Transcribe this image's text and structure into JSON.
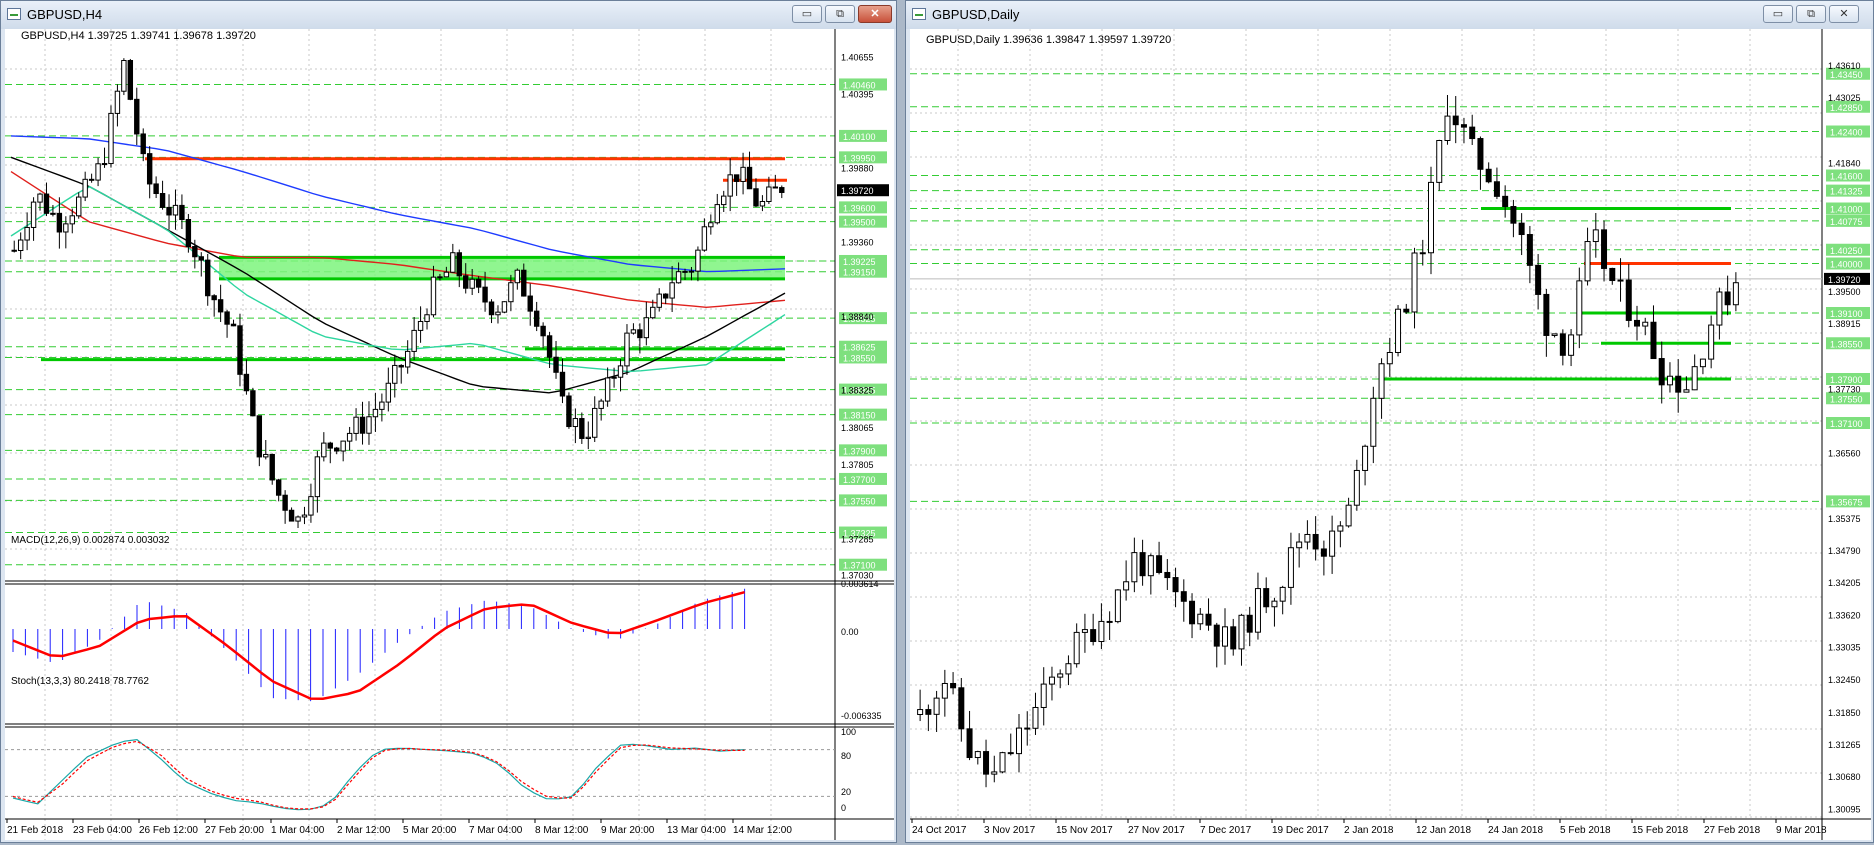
{
  "windows": {
    "h4": {
      "title": "GBPUSD,H4",
      "header": "GBPUSD,H4  1.39725 1.39741 1.39678 1.39720",
      "current_price": "1.39720",
      "price_labels": [
        "1.40655",
        "1.40395",
        "1.39880",
        "1.39360",
        "1.38840",
        "1.38325",
        "1.38065",
        "1.37805",
        "1.37285",
        "1.37030"
      ],
      "green_labels": [
        "1.40460",
        "1.40100",
        "1.39950",
        "1.39600",
        "1.39500",
        "1.39225",
        "1.39150",
        "1.38825",
        "1.38625",
        "1.38550",
        "1.38325",
        "1.38150",
        "1.37900",
        "1.37700",
        "1.37550",
        "1.37325",
        "1.37100"
      ],
      "macd": {
        "header": "MACD(12,26,9) 0.002874 0.003032",
        "labels": [
          "0.003614",
          "0.00",
          "-0.006335"
        ]
      },
      "stoch": {
        "header": "Stoch(13,3,3) 80.2418 78.7762",
        "labels": [
          "100",
          "80",
          "20",
          "0"
        ]
      },
      "time_labels": [
        "21 Feb 2018",
        "23 Feb 04:00",
        "26 Feb 12:00",
        "27 Feb 20:00",
        "1 Mar 04:00",
        "2 Mar 12:00",
        "5 Mar 20:00",
        "7 Mar 04:00",
        "8 Mar 12:00",
        "9 Mar 20:00",
        "13 Mar 04:00",
        "14 Mar 12:00"
      ]
    },
    "daily": {
      "title": "GBPUSD,Daily",
      "header": "GBPUSD,Daily  1.39636 1.39847 1.39597 1.39720",
      "current_price": "1.39720",
      "price_labels": [
        "1.43610",
        "1.43025",
        "1.41840",
        "1.39500",
        "1.38915",
        "1.37730",
        "1.36560",
        "1.35375",
        "1.34790",
        "1.34205",
        "1.33620",
        "1.33035",
        "1.32450",
        "1.31850",
        "1.31265",
        "1.30680",
        "1.30095"
      ],
      "green_labels": [
        "1.43450",
        "1.42850",
        "1.42400",
        "1.41600",
        "1.41325",
        "1.41000",
        "1.40775",
        "1.40250",
        "1.40000",
        "1.39100",
        "1.38550",
        "1.37900",
        "1.37550",
        "1.37100",
        "1.35675"
      ],
      "time_labels": [
        "24 Oct 2017",
        "3 Nov 2017",
        "15 Nov 2017",
        "27 Nov 2017",
        "7 Dec 2017",
        "19 Dec 2017",
        "2 Jan 2018",
        "12 Jan 2018",
        "24 Jan 2018",
        "5 Feb 2018",
        "15 Feb 2018",
        "27 Feb 2018",
        "9 Mar 2018"
      ]
    }
  },
  "controls": {
    "minimize": "▭",
    "restore": "⧉",
    "close": "✕"
  },
  "colors": {
    "resistance": "#ff3300",
    "support": "#00c800",
    "ma_blue": "#1e3cff",
    "ma_red": "#e0201c",
    "ma_black": "#000000",
    "ma_aqua": "#2ed6a0",
    "macd_signal": "#ff0000",
    "macd_hist": "#2020ff",
    "stoch_main": "#1aa8a8",
    "stoch_signal": "#ff0000",
    "label_green": "#7ee07e"
  }
}
